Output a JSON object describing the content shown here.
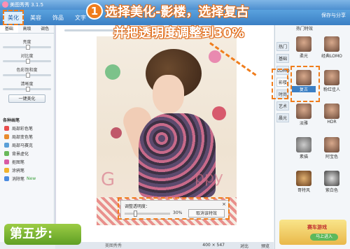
{
  "app": {
    "title": "美图秀秀 3.1.5"
  },
  "tabs": [
    {
      "label": "美化"
    },
    {
      "label": "美容"
    },
    {
      "label": "饰品"
    },
    {
      "label": "文字"
    }
  ],
  "top_right": {
    "save": "保存与分享"
  },
  "left_panel": {
    "subtabs": [
      "基础",
      "高级",
      "调色"
    ],
    "sliders": [
      {
        "label": "亮度",
        "value": 0.5
      },
      {
        "label": "对比度",
        "value": 0.5
      },
      {
        "label": "色彩饱和度",
        "value": 0.5
      },
      {
        "label": "清晰度",
        "value": 0.5
      }
    ],
    "one_key_button": "一键美化",
    "brushes_title": "各种画笔",
    "brushes": [
      {
        "label": "局部彩色笔"
      },
      {
        "label": "局部变色笔"
      },
      {
        "label": "局部马赛克"
      },
      {
        "label": "背景虚化"
      },
      {
        "label": "抠图笔"
      },
      {
        "label": "涂鸦笔"
      },
      {
        "label": "消除笔",
        "badge": "New"
      }
    ]
  },
  "canvas": {
    "photo_text_left": "G",
    "photo_text_right": "ppy",
    "opacity_dialog": {
      "label": "调整透明度：",
      "value_text": "30%",
      "value": 0.3,
      "cancel": "取消该特效"
    },
    "status": {
      "size": "400 × 547",
      "compare": "对比",
      "preview": "预览"
    }
  },
  "right_panel": {
    "header": "热门特效",
    "categories": [
      "热门",
      "基础",
      "LOMO",
      "影楼",
      "时尚",
      "艺术",
      "晨光"
    ],
    "effects": [
      {
        "name": "柔光"
      },
      {
        "name": "经典LOMO"
      },
      {
        "name": "复古"
      },
      {
        "name": "粉红佳人"
      },
      {
        "name": "淡雅"
      },
      {
        "name": "HDR"
      },
      {
        "name": "素描"
      },
      {
        "name": "阿宝色"
      },
      {
        "name": "哥特风"
      },
      {
        "name": "紫白色"
      }
    ],
    "selected_effect": "复古",
    "ad_text": "赛车游戏",
    "ad_button": "马上进入"
  },
  "annotation": {
    "number": "1",
    "line1": "选择美化-影楼，选择复古",
    "line2": "并把透明度调整到30%",
    "step": "第五步:"
  },
  "bottom_url": "美图秀秀"
}
